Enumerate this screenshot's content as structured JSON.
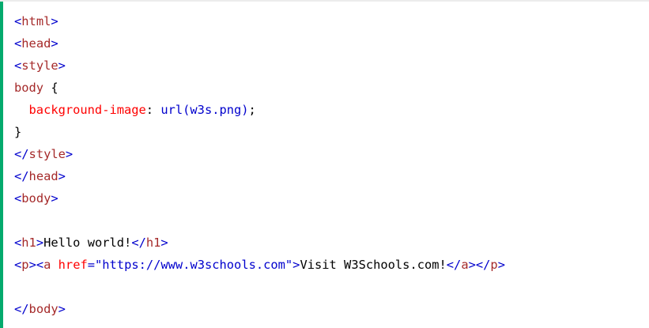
{
  "code_example": {
    "accent_color": "#04aa6d",
    "colors": {
      "bracket": "#0000cd",
      "tag": "#a52a2a",
      "property": "#ff0000",
      "value": "#0000cd",
      "text": "#000000"
    },
    "lines": [
      [
        {
          "c": "b",
          "t": "<"
        },
        {
          "c": "t",
          "t": "html"
        },
        {
          "c": "b",
          "t": ">"
        }
      ],
      [
        {
          "c": "b",
          "t": "<"
        },
        {
          "c": "t",
          "t": "head"
        },
        {
          "c": "b",
          "t": ">"
        }
      ],
      [
        {
          "c": "b",
          "t": "<"
        },
        {
          "c": "t",
          "t": "style"
        },
        {
          "c": "b",
          "t": ">"
        }
      ],
      [
        {
          "c": "t",
          "t": "body "
        },
        {
          "c": "x",
          "t": "{"
        }
      ],
      [
        {
          "c": "a",
          "t": "  background-image"
        },
        {
          "c": "x",
          "t": ": "
        },
        {
          "c": "v",
          "t": "url(w3s.png)"
        },
        {
          "c": "x",
          "t": ";"
        }
      ],
      [
        {
          "c": "x",
          "t": "}"
        }
      ],
      [
        {
          "c": "b",
          "t": "</"
        },
        {
          "c": "t",
          "t": "style"
        },
        {
          "c": "b",
          "t": ">"
        }
      ],
      [
        {
          "c": "b",
          "t": "</"
        },
        {
          "c": "t",
          "t": "head"
        },
        {
          "c": "b",
          "t": ">"
        }
      ],
      [
        {
          "c": "b",
          "t": "<"
        },
        {
          "c": "t",
          "t": "body"
        },
        {
          "c": "b",
          "t": ">"
        }
      ],
      [],
      [
        {
          "c": "b",
          "t": "<"
        },
        {
          "c": "t",
          "t": "h1"
        },
        {
          "c": "b",
          "t": ">"
        },
        {
          "c": "x",
          "t": "Hello world!"
        },
        {
          "c": "b",
          "t": "</"
        },
        {
          "c": "t",
          "t": "h1"
        },
        {
          "c": "b",
          "t": ">"
        }
      ],
      [
        {
          "c": "b",
          "t": "<"
        },
        {
          "c": "t",
          "t": "p"
        },
        {
          "c": "b",
          "t": "><"
        },
        {
          "c": "t",
          "t": "a "
        },
        {
          "c": "a",
          "t": "href"
        },
        {
          "c": "b",
          "t": "=\"https://www.w3schools.com\">"
        },
        {
          "c": "x",
          "t": "Visit W3Schools.com!"
        },
        {
          "c": "b",
          "t": "</"
        },
        {
          "c": "t",
          "t": "a"
        },
        {
          "c": "b",
          "t": "></"
        },
        {
          "c": "t",
          "t": "p"
        },
        {
          "c": "b",
          "t": ">"
        }
      ],
      [],
      [
        {
          "c": "b",
          "t": "</"
        },
        {
          "c": "t",
          "t": "body"
        },
        {
          "c": "b",
          "t": ">"
        }
      ]
    ]
  }
}
